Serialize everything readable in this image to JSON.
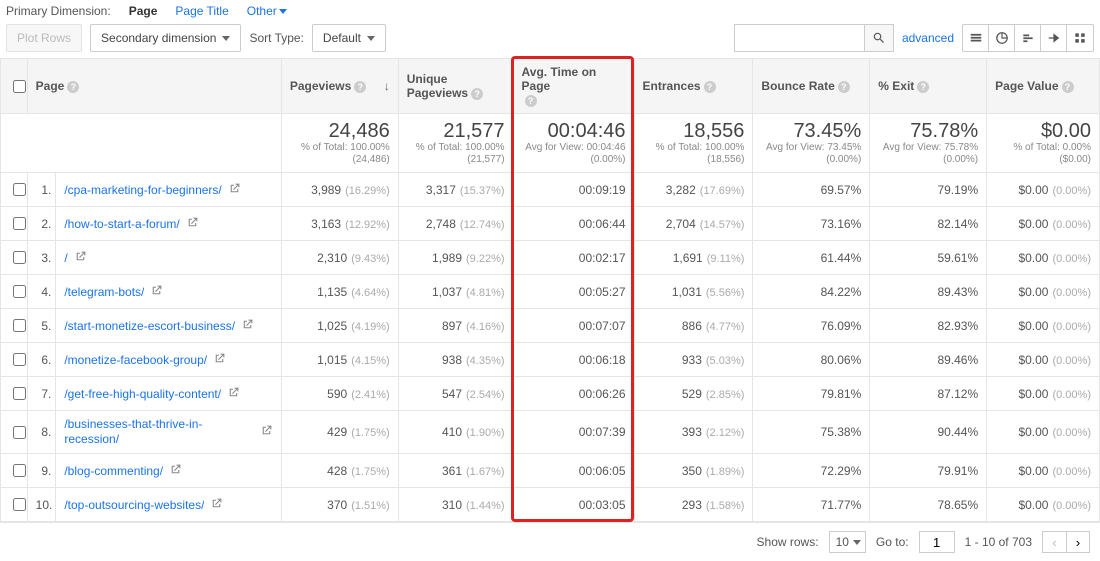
{
  "dimension": {
    "label": "Primary Dimension:",
    "active": "Page",
    "alt1": "Page Title",
    "alt2": "Other"
  },
  "controls": {
    "plotRows": "Plot Rows",
    "secondaryDimension": "Secondary dimension",
    "sortTypeLabel": "Sort Type:",
    "sortDefault": "Default",
    "advanced": "advanced"
  },
  "headers": {
    "page": "Page",
    "pageviews": "Pageviews",
    "uniquePageviews": "Unique Pageviews",
    "avgTime": "Avg. Time on Page",
    "entrances": "Entrances",
    "bounceRate": "Bounce Rate",
    "pctExit": "% Exit",
    "pageValue": "Page Value"
  },
  "summary": {
    "pageviews": {
      "big": "24,486",
      "small1": "% of Total: 100.00%",
      "small2": "(24,486)"
    },
    "uniquePageviews": {
      "big": "21,577",
      "small1": "% of Total: 100.00%",
      "small2": "(21,577)"
    },
    "avgTime": {
      "big": "00:04:46",
      "small1": "Avg for View: 00:04:46",
      "small2": "(0.00%)"
    },
    "entrances": {
      "big": "18,556",
      "small1": "% of Total: 100.00%",
      "small2": "(18,556)"
    },
    "bounceRate": {
      "big": "73.45%",
      "small1": "Avg for View: 73.45%",
      "small2": "(0.00%)"
    },
    "pctExit": {
      "big": "75.78%",
      "small1": "Avg for View: 75.78%",
      "small2": "(0.00%)"
    },
    "pageValue": {
      "big": "$0.00",
      "small1": "% of Total: 0.00%",
      "small2": "($0.00)"
    }
  },
  "rows": [
    {
      "idx": "1.",
      "page": "/cpa-marketing-for-beginners/",
      "pv": "3,989",
      "pvp": "(16.29%)",
      "upv": "3,317",
      "upvp": "(15.37%)",
      "time": "00:09:19",
      "ent": "3,282",
      "entp": "(17.69%)",
      "br": "69.57%",
      "ex": "79.19%",
      "val": "$0.00",
      "valp": "(0.00%)"
    },
    {
      "idx": "2.",
      "page": "/how-to-start-a-forum/",
      "pv": "3,163",
      "pvp": "(12.92%)",
      "upv": "2,748",
      "upvp": "(12.74%)",
      "time": "00:06:44",
      "ent": "2,704",
      "entp": "(14.57%)",
      "br": "73.16%",
      "ex": "82.14%",
      "val": "$0.00",
      "valp": "(0.00%)"
    },
    {
      "idx": "3.",
      "page": "/",
      "pv": "2,310",
      "pvp": "(9.43%)",
      "upv": "1,989",
      "upvp": "(9.22%)",
      "time": "00:02:17",
      "ent": "1,691",
      "entp": "(9.11%)",
      "br": "61.44%",
      "ex": "59.61%",
      "val": "$0.00",
      "valp": "(0.00%)"
    },
    {
      "idx": "4.",
      "page": "/telegram-bots/",
      "pv": "1,135",
      "pvp": "(4.64%)",
      "upv": "1,037",
      "upvp": "(4.81%)",
      "time": "00:05:27",
      "ent": "1,031",
      "entp": "(5.56%)",
      "br": "84.22%",
      "ex": "89.43%",
      "val": "$0.00",
      "valp": "(0.00%)"
    },
    {
      "idx": "5.",
      "page": "/start-monetize-escort-business/",
      "pv": "1,025",
      "pvp": "(4.19%)",
      "upv": "897",
      "upvp": "(4.16%)",
      "time": "00:07:07",
      "ent": "886",
      "entp": "(4.77%)",
      "br": "76.09%",
      "ex": "82.93%",
      "val": "$0.00",
      "valp": "(0.00%)"
    },
    {
      "idx": "6.",
      "page": "/monetize-facebook-group/",
      "pv": "1,015",
      "pvp": "(4.15%)",
      "upv": "938",
      "upvp": "(4.35%)",
      "time": "00:06:18",
      "ent": "933",
      "entp": "(5.03%)",
      "br": "80.06%",
      "ex": "89.46%",
      "val": "$0.00",
      "valp": "(0.00%)"
    },
    {
      "idx": "7.",
      "page": "/get-free-high-quality-content/",
      "pv": "590",
      "pvp": "(2.41%)",
      "upv": "547",
      "upvp": "(2.54%)",
      "time": "00:06:26",
      "ent": "529",
      "entp": "(2.85%)",
      "br": "79.81%",
      "ex": "87.12%",
      "val": "$0.00",
      "valp": "(0.00%)"
    },
    {
      "idx": "8.",
      "page": "/businesses-that-thrive-in-recession/",
      "pv": "429",
      "pvp": "(1.75%)",
      "upv": "410",
      "upvp": "(1.90%)",
      "time": "00:07:39",
      "ent": "393",
      "entp": "(2.12%)",
      "br": "75.38%",
      "ex": "90.44%",
      "val": "$0.00",
      "valp": "(0.00%)",
      "wrap": true
    },
    {
      "idx": "9.",
      "page": "/blog-commenting/",
      "pv": "428",
      "pvp": "(1.75%)",
      "upv": "361",
      "upvp": "(1.67%)",
      "time": "00:06:05",
      "ent": "350",
      "entp": "(1.89%)",
      "br": "72.29%",
      "ex": "79.91%",
      "val": "$0.00",
      "valp": "(0.00%)"
    },
    {
      "idx": "10.",
      "page": "/top-outsourcing-websites/",
      "pv": "370",
      "pvp": "(1.51%)",
      "upv": "310",
      "upvp": "(1.44%)",
      "time": "00:03:05",
      "ent": "293",
      "entp": "(1.58%)",
      "br": "71.77%",
      "ex": "78.65%",
      "val": "$0.00",
      "valp": "(0.00%)"
    }
  ],
  "footer": {
    "showRowsLabel": "Show rows:",
    "showRowsValue": "10",
    "goToLabel": "Go to:",
    "goToValue": "1",
    "rangeText": "1 - 10 of 703"
  }
}
